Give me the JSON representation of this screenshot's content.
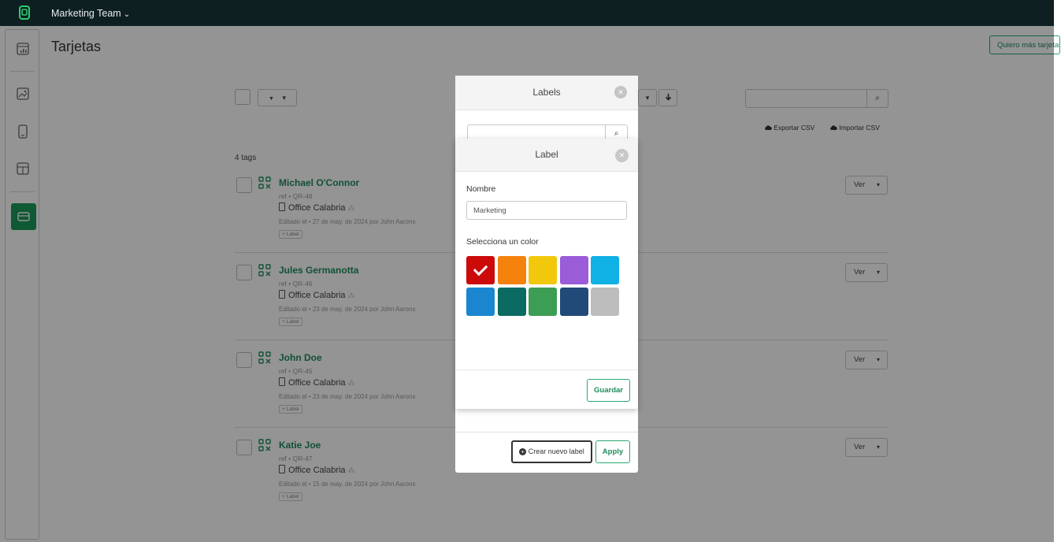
{
  "topbar": {
    "team": "Marketing Team",
    "team_chevron": "⌄"
  },
  "page": {
    "title": "Tarjetas",
    "more_button": "Quiero más tarjetas"
  },
  "toolbar": {
    "filter_icon": "▼",
    "caret": "▾",
    "search_icon": "⌕",
    "export_csv": "Exportar CSV",
    "import_csv": "Importar CSV",
    "count": "4 tags"
  },
  "cards": [
    {
      "name": "Michael O'Connor",
      "ref": "ref • QR-48",
      "office": "Office Calabria",
      "edited": "Editado el • 27 de may. de 2024 por John Aarons",
      "label": "+ Label",
      "ver": "Ver"
    },
    {
      "name": "Jules Germanotta",
      "ref": "ref • QR-46",
      "office": "Office Calabria",
      "edited": "Editado el • 23 de may. de 2024 por John Aarons",
      "label": "+ Label",
      "ver": "Ver"
    },
    {
      "name": "John Doe",
      "ref": "ref • QR-45",
      "office": "Office Calabria",
      "edited": "Editado el • 23 de may. de 2024 por John Aarons",
      "label": "+ Label",
      "ver": "Ver"
    },
    {
      "name": "Katie Joe",
      "ref": "ref • QR-47",
      "office": "Office Calabria",
      "edited": "Editado el • 15 de may. de 2024 por John Aarons",
      "label": "+ Label",
      "ver": "Ver"
    }
  ],
  "labels_modal": {
    "title": "Labels",
    "close": "✕",
    "create_button": "Crear nuevo label",
    "apply_button": "Apply"
  },
  "label_modal": {
    "title": "Label",
    "close": "✕",
    "name_label": "Nombre",
    "name_value": "Marketing",
    "color_label": "Selecciona un color",
    "colors": [
      "#cc0a0a",
      "#f5820d",
      "#f2c80c",
      "#9a5cd8",
      "#10b1e4",
      "#1a86d0",
      "#0b6b62",
      "#3c9d55",
      "#224a78",
      "#bdbdbd"
    ],
    "selected_color": "#cc0a0a",
    "save_button": "Guardar"
  }
}
